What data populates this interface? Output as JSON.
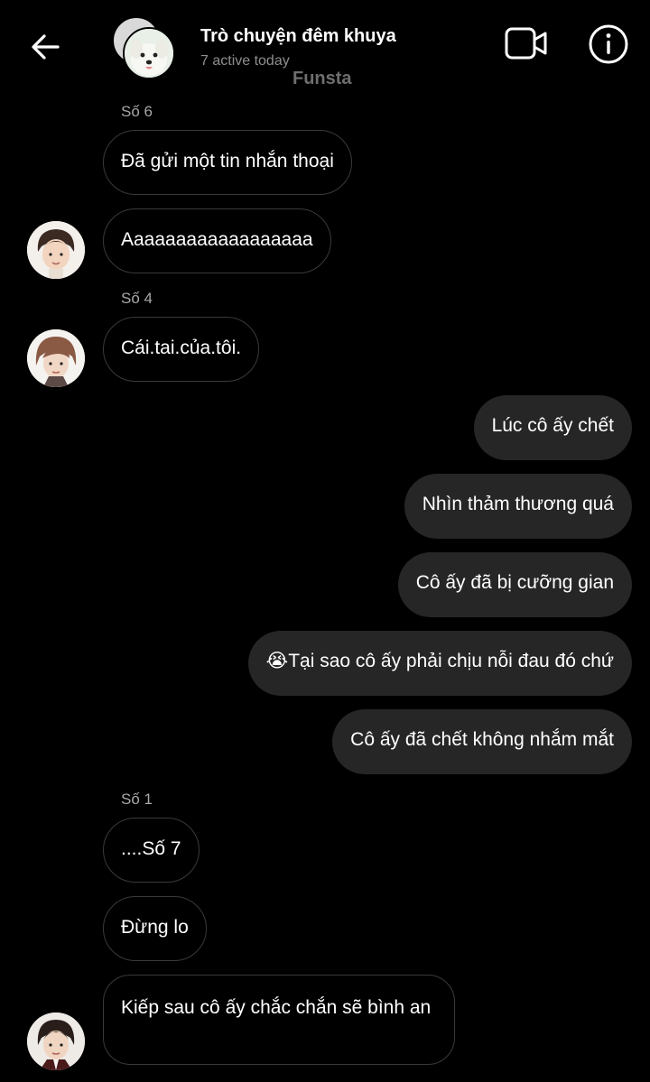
{
  "header": {
    "title": "Trò chuyện đêm khuya",
    "subtitle": "7 active today",
    "watermark": "Funsta",
    "icons": [
      "back-arrow-icon",
      "video-call-icon",
      "info-icon"
    ]
  },
  "messages": [
    {
      "sender": "Số 6",
      "text": "Đã gửi một tin nhắn thoại",
      "direction": "in"
    },
    {
      "text": "Aaaaaaaaaaaaaaaaaa",
      "direction": "in"
    },
    {
      "sender": "Số 4",
      "text": "Cái.tai.của.tôi.",
      "direction": "in"
    },
    {
      "text": "Lúc cô ấy chết",
      "direction": "out"
    },
    {
      "text": "Nhìn thảm thương quá",
      "direction": "out"
    },
    {
      "text": "Cô ấy đã bị cưỡng gian",
      "direction": "out"
    },
    {
      "text": "Tại sao cô ấy phải chịu nỗi đau đó chứ",
      "emoji": "😭",
      "direction": "out"
    },
    {
      "text": "Cô ấy đã chết không nhắm mắt",
      "direction": "out"
    },
    {
      "sender": "Số 1",
      "text": "....Số 7",
      "direction": "in"
    },
    {
      "text": "Đừng lo",
      "direction": "in"
    },
    {
      "text": "Kiếp sau cô ấy chắc chắn sẽ bình an",
      "direction": "in"
    }
  ]
}
